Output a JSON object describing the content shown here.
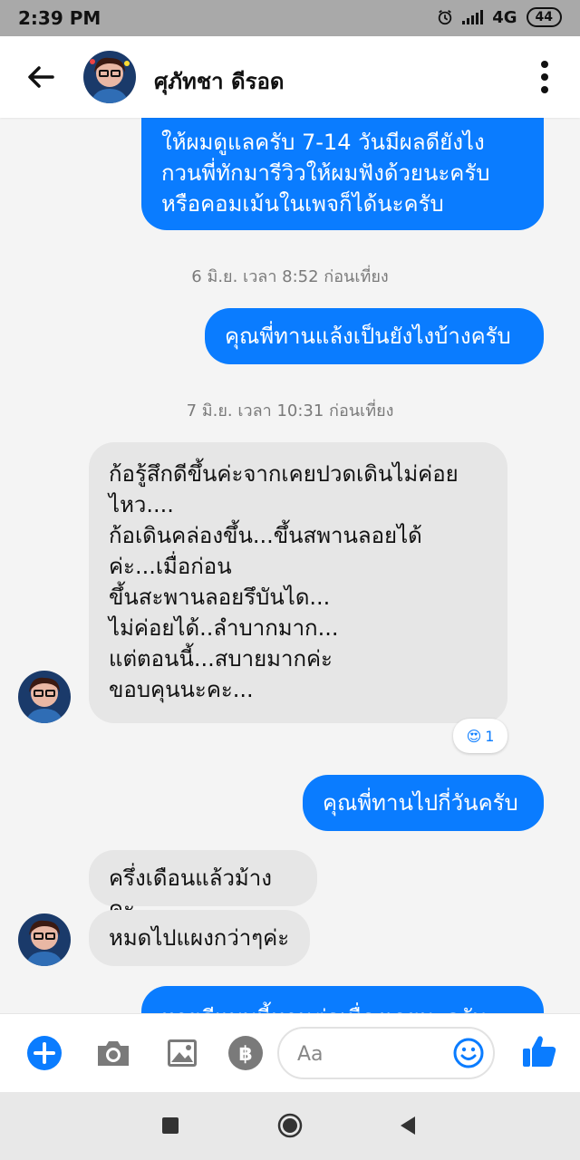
{
  "status_bar": {
    "time": "2:39 PM",
    "network": "4G",
    "battery": "44"
  },
  "header": {
    "contact_name": "ศุภัทชา ดีรอด"
  },
  "messages": [
    {
      "id": "m1",
      "sender": "me",
      "lines": [
        "ให้ผมดูแลครับ 7-14 วันมีผลดียังไง",
        "กวนพี่ทักมารีวิวให้ผมฟังด้วยนะครับ",
        "หรือคอมเม้นในเพจก็ได้นะครับ"
      ]
    },
    {
      "id": "t1",
      "type": "timestamp",
      "text": "6 มิ.ย. เวลา 8:52 ก่อนเที่ยง"
    },
    {
      "id": "m2",
      "sender": "me",
      "lines": [
        "คุณพี่ทานแล้งเป็นยังไงบ้างครับ"
      ]
    },
    {
      "id": "t2",
      "type": "timestamp",
      "text": "7 มิ.ย. เวลา 10:31 ก่อนเที่ยง"
    },
    {
      "id": "m3",
      "sender": "contact",
      "lines": [
        "ก้อรู้สึกดีขึ้นค่ะจากเคยปวดเดินไม่ค่อย",
        "ไหว....",
        "ก้อเดินคล่องขึ้น...ขึ้นสพานลอยได้",
        "ค่ะ...เมื่อก่อน",
        "ขึ้นสะพานลอยรึบันได...",
        "ไม่ค่อยได้..ลำบากมาก...",
        "แต่ตอนนี้...สบายมากค่ะ",
        "ขอบคุนนะคะ..."
      ],
      "reaction": {
        "emoji": "😍",
        "count": "1"
      }
    },
    {
      "id": "m4",
      "sender": "me",
      "lines": [
        "คุณพี่ทานไปกี่วันครับ"
      ]
    },
    {
      "id": "m5",
      "sender": "contact",
      "lines": [
        "ครึ่งเดือนแล้วม้างคะ"
      ]
    },
    {
      "id": "m6",
      "sender": "contact",
      "lines": [
        "หมดไปแผงกว่าๆค่ะ"
      ]
    },
    {
      "id": "m7",
      "sender": "me",
      "lines": [
        "หายดีแบบนี้ทานต่อเนื่องเลยนะครับ"
      ]
    }
  ],
  "composer": {
    "placeholder": "Aa"
  },
  "icons": {
    "back": "arrow-left-icon",
    "menu": "more-vertical-icon",
    "add": "plus-circle-icon",
    "camera": "camera-icon",
    "gallery": "image-icon",
    "payment": "baht-icon",
    "emoji": "smiley-icon",
    "like": "thumbs-up-icon"
  },
  "colors": {
    "outgoing_bubble": "#0a7cff",
    "incoming_bubble": "#e6e6e6",
    "accent": "#0a7cff"
  }
}
